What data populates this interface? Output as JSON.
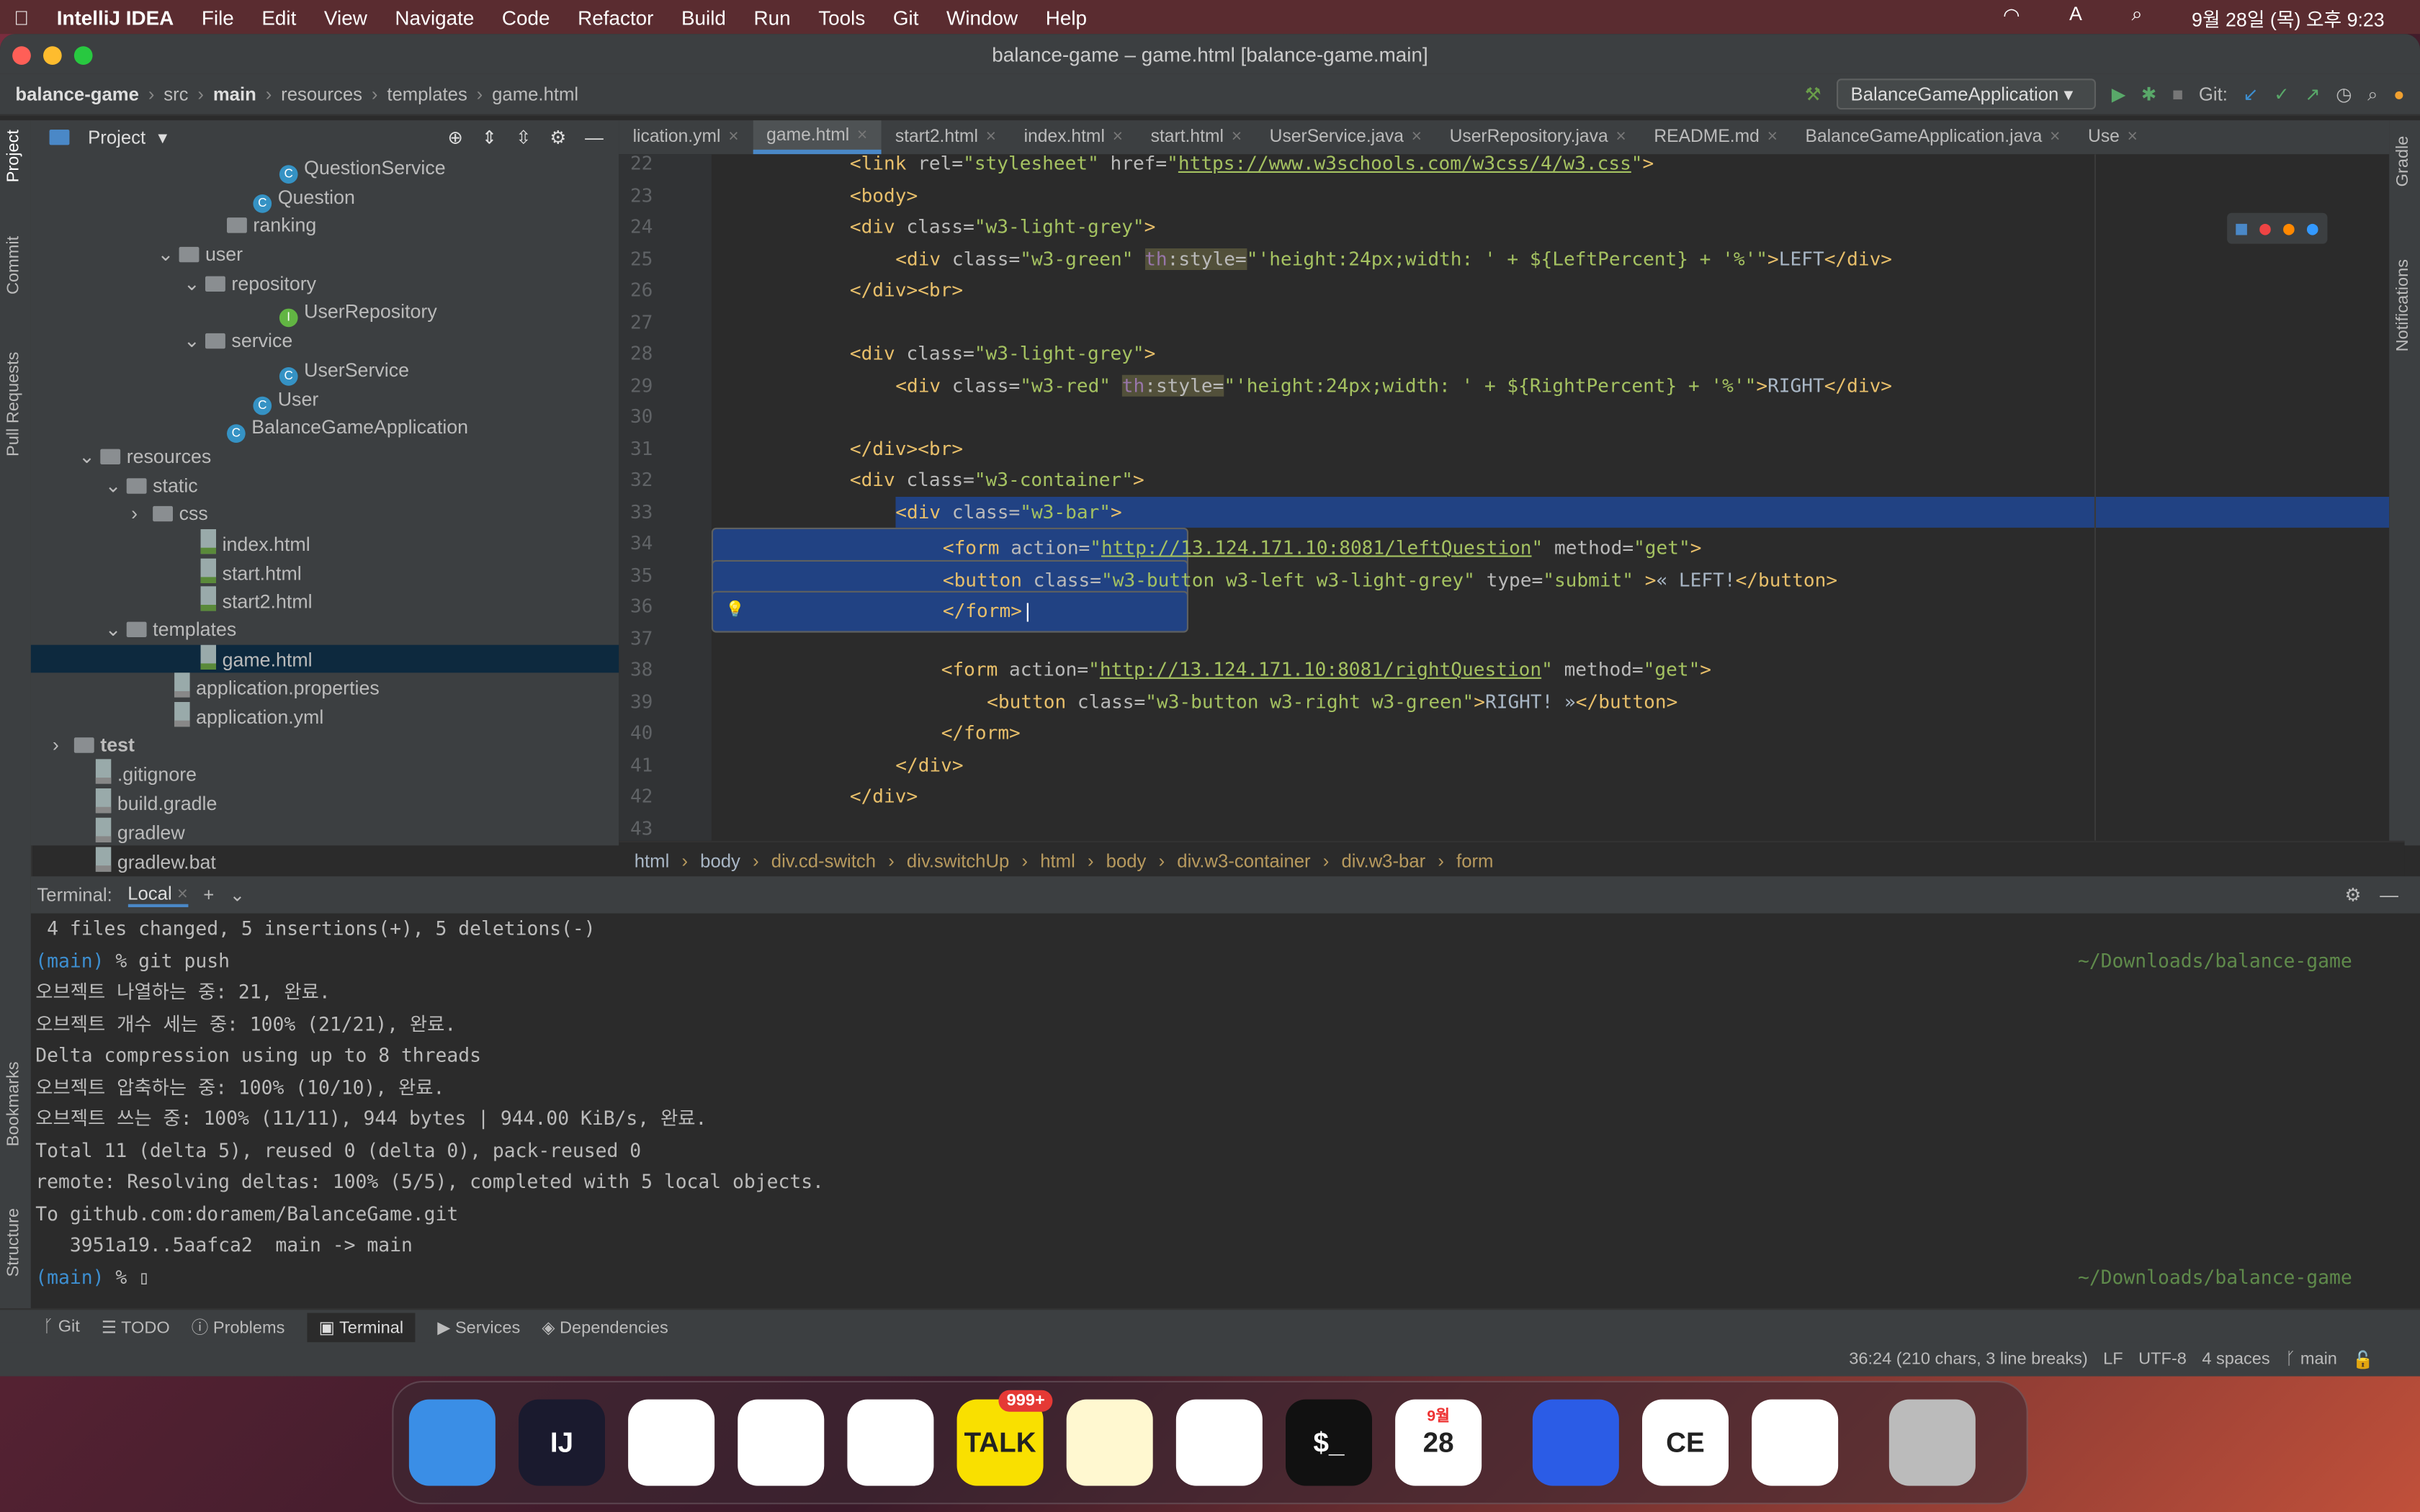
{
  "menubar": {
    "app": "IntelliJ IDEA",
    "items": [
      "File",
      "Edit",
      "View",
      "Navigate",
      "Code",
      "Refactor",
      "Build",
      "Run",
      "Tools",
      "Git",
      "Window",
      "Help"
    ],
    "clock": "9월 28일 (목) 오후 9:23",
    "input_indicator": "A"
  },
  "window": {
    "title": "balance-game – game.html [balance-game.main]"
  },
  "navbar": {
    "crumbs": [
      "balance-game",
      "src",
      "main",
      "resources",
      "templates",
      "game.html"
    ],
    "run_config": "BalanceGameApplication",
    "git_label": "Git:"
  },
  "left_strip": [
    "Project",
    "Commit",
    "Pull Requests",
    "Bookmarks",
    "Structure"
  ],
  "right_strip": [
    "Gradle",
    "Notifications"
  ],
  "project": {
    "title": "Project",
    "tree": [
      {
        "label": "QuestionService",
        "indent": 9,
        "icon": "class"
      },
      {
        "label": "Question",
        "indent": 8,
        "icon": "class"
      },
      {
        "label": "ranking",
        "indent": 7,
        "icon": "folder"
      },
      {
        "label": "user",
        "indent": 6,
        "icon": "folder",
        "open": true
      },
      {
        "label": "repository",
        "indent": 7,
        "icon": "folder",
        "open": true
      },
      {
        "label": "UserRepository",
        "indent": 9,
        "icon": "interface"
      },
      {
        "label": "service",
        "indent": 7,
        "icon": "folder",
        "open": true
      },
      {
        "label": "UserService",
        "indent": 9,
        "icon": "class"
      },
      {
        "label": "User",
        "indent": 8,
        "icon": "class"
      },
      {
        "label": "BalanceGameApplication",
        "indent": 7,
        "icon": "class"
      },
      {
        "label": "resources",
        "indent": 3,
        "icon": "folder",
        "open": true
      },
      {
        "label": "static",
        "indent": 4,
        "icon": "folder",
        "open": true
      },
      {
        "label": "css",
        "indent": 5,
        "icon": "folder",
        "closed": true
      },
      {
        "label": "index.html",
        "indent": 6,
        "icon": "html"
      },
      {
        "label": "start.html",
        "indent": 6,
        "icon": "html"
      },
      {
        "label": "start2.html",
        "indent": 6,
        "icon": "html"
      },
      {
        "label": "templates",
        "indent": 4,
        "icon": "folder",
        "open": true
      },
      {
        "label": "game.html",
        "indent": 6,
        "icon": "html",
        "selected": true
      },
      {
        "label": "application.properties",
        "indent": 5,
        "icon": "file"
      },
      {
        "label": "application.yml",
        "indent": 5,
        "icon": "file"
      },
      {
        "label": "test",
        "indent": 2,
        "icon": "folder",
        "closed": true
      },
      {
        "label": ".gitignore",
        "indent": 2,
        "icon": "file"
      },
      {
        "label": "build.gradle",
        "indent": 2,
        "icon": "file"
      },
      {
        "label": "gradlew",
        "indent": 2,
        "icon": "file"
      },
      {
        "label": "gradlew.bat",
        "indent": 2,
        "icon": "file"
      }
    ]
  },
  "tabs": [
    {
      "label": "lication.yml"
    },
    {
      "label": "game.html",
      "active": true
    },
    {
      "label": "start2.html"
    },
    {
      "label": "index.html"
    },
    {
      "label": "start.html"
    },
    {
      "label": "UserService.java"
    },
    {
      "label": "UserRepository.java"
    },
    {
      "label": "README.md"
    },
    {
      "label": "BalanceGameApplication.java"
    },
    {
      "label": "Use"
    }
  ],
  "editor": {
    "lines": [
      {
        "n": 22,
        "tokens": [
          [
            "t",
            "<link "
          ],
          [
            "a",
            "rel="
          ],
          [
            "s",
            "\"stylesheet\" "
          ],
          [
            "a",
            "href="
          ],
          [
            "s",
            "\""
          ],
          [
            "u",
            "https://www.w3schools.com/w3css/4/w3.css"
          ],
          [
            "s",
            "\""
          ],
          [
            "t",
            ">"
          ]
        ],
        "indent": 4
      },
      {
        "n": 23,
        "tokens": [
          [
            "t",
            "<body>"
          ]
        ],
        "indent": 4
      },
      {
        "n": 24,
        "tokens": [
          [
            "t",
            "<div "
          ],
          [
            "a",
            "class="
          ],
          [
            "s",
            "\"w3-light-grey\""
          ],
          [
            "t",
            ">"
          ]
        ],
        "indent": 4
      },
      {
        "n": 25,
        "tokens": [
          [
            "t",
            "<div "
          ],
          [
            "a",
            "class="
          ],
          [
            "s",
            "\"w3-green\" "
          ],
          [
            "p",
            "th"
          ],
          [
            "a",
            ":style="
          ],
          [
            "s",
            "\"'height:24px;width: ' + ${LeftPercent} + '%'\""
          ],
          [
            "t",
            ">"
          ],
          [
            "w",
            "LEFT"
          ],
          [
            "t",
            "</div>"
          ]
        ],
        "indent": 8
      },
      {
        "n": 26,
        "tokens": [
          [
            "t",
            "</div><br>"
          ]
        ],
        "indent": 4
      },
      {
        "n": 27,
        "tokens": [],
        "indent": 0
      },
      {
        "n": 28,
        "tokens": [
          [
            "t",
            "<div "
          ],
          [
            "a",
            "class="
          ],
          [
            "s",
            "\"w3-light-grey\""
          ],
          [
            "t",
            ">"
          ]
        ],
        "indent": 4
      },
      {
        "n": 29,
        "tokens": [
          [
            "t",
            "<div "
          ],
          [
            "a",
            "class="
          ],
          [
            "s",
            "\"w3-red\" "
          ],
          [
            "p",
            "th"
          ],
          [
            "a",
            ":style="
          ],
          [
            "s",
            "\"'height:24px;width: ' + ${RightPercent} + '%'\""
          ],
          [
            "t",
            ">"
          ],
          [
            "w",
            "RIGHT"
          ],
          [
            "t",
            "</div>"
          ]
        ],
        "indent": 8
      },
      {
        "n": 30,
        "tokens": [],
        "indent": 0
      },
      {
        "n": 31,
        "tokens": [
          [
            "t",
            "</div><br>"
          ]
        ],
        "indent": 4
      },
      {
        "n": 32,
        "tokens": [
          [
            "t",
            "<div "
          ],
          [
            "a",
            "class="
          ],
          [
            "s",
            "\"w3-container\""
          ],
          [
            "t",
            ">"
          ]
        ],
        "indent": 4
      },
      {
        "n": 33,
        "tokens": [
          [
            "t",
            "<div "
          ],
          [
            "a",
            "class="
          ],
          [
            "s",
            "\"w3-bar\""
          ],
          [
            "t",
            ">"
          ]
        ],
        "indent": 8,
        "selected_from": 8
      },
      {
        "n": 34,
        "tokens": [
          [
            "t",
            "<form "
          ],
          [
            "a",
            "action="
          ],
          [
            "s",
            "\""
          ],
          [
            "u",
            "http://13.124.171.10:8081/leftQuestion"
          ],
          [
            "s",
            "\" "
          ],
          [
            "a",
            "method="
          ],
          [
            "s",
            "\"get\""
          ],
          [
            "t",
            ">"
          ]
        ],
        "indent": 12,
        "selected": true
      },
      {
        "n": 35,
        "tokens": [
          [
            "t",
            "<button "
          ],
          [
            "a",
            "class="
          ],
          [
            "s",
            "\"w3-button w3-left w3-light-grey\" "
          ],
          [
            "a",
            "type="
          ],
          [
            "s",
            "\"submit\" "
          ],
          [
            "t",
            ">"
          ],
          [
            "w",
            "« LEFT!"
          ],
          [
            "t",
            "</button>"
          ]
        ],
        "indent": 12,
        "selected": true
      },
      {
        "n": 36,
        "tokens": [
          [
            "t",
            "</form>"
          ]
        ],
        "indent": 12,
        "selected": true,
        "current": true
      },
      {
        "n": 37,
        "tokens": [],
        "indent": 0
      },
      {
        "n": 38,
        "tokens": [
          [
            "t",
            "<form "
          ],
          [
            "a",
            "action="
          ],
          [
            "s",
            "\""
          ],
          [
            "u",
            "http://13.124.171.10:8081/rightQuestion"
          ],
          [
            "s",
            "\" "
          ],
          [
            "a",
            "method="
          ],
          [
            "s",
            "\"get\""
          ],
          [
            "t",
            ">"
          ]
        ],
        "indent": 12
      },
      {
        "n": 39,
        "tokens": [
          [
            "t",
            "<button "
          ],
          [
            "a",
            "class="
          ],
          [
            "s",
            "\"w3-button w3-right w3-green\""
          ],
          [
            "t",
            ">"
          ],
          [
            "w",
            "RIGHT! »"
          ],
          [
            "t",
            "</button>"
          ]
        ],
        "indent": 16
      },
      {
        "n": 40,
        "tokens": [
          [
            "t",
            "</form>"
          ]
        ],
        "indent": 12
      },
      {
        "n": 41,
        "tokens": [
          [
            "t",
            "</div>"
          ]
        ],
        "indent": 8
      },
      {
        "n": 42,
        "tokens": [
          [
            "t",
            "</div>"
          ]
        ],
        "indent": 4
      },
      {
        "n": 43,
        "tokens": [],
        "indent": 0
      }
    ]
  },
  "breadcrumb": [
    "html",
    "body",
    "div.cd-switch",
    "div.switchUp",
    "html",
    "body",
    "div.w3-container",
    "div.w3-bar",
    "form"
  ],
  "terminal": {
    "label": "Terminal:",
    "tab": "Local",
    "lines": [
      {
        "text": " 4 files changed, 5 insertions(+), 5 deletions(-)"
      },
      {
        "prompt": "(main)",
        "text": " % git push",
        "path": "~/Downloads/balance-game"
      },
      {
        "text": "오브젝트 나열하는 중: 21, 완료."
      },
      {
        "text": "오브젝트 개수 세는 중: 100% (21/21), 완료."
      },
      {
        "text": "Delta compression using up to 8 threads"
      },
      {
        "text": "오브젝트 압축하는 중: 100% (10/10), 완료."
      },
      {
        "text": "오브젝트 쓰는 중: 100% (11/11), 944 bytes | 944.00 KiB/s, 완료."
      },
      {
        "text": "Total 11 (delta 5), reused 0 (delta 0), pack-reused 0"
      },
      {
        "text": "remote: Resolving deltas: 100% (5/5), completed with 5 local objects."
      },
      {
        "text": "To github.com:doramem/BalanceGame.git"
      },
      {
        "text": "   3951a19..5aafca2  main -> main"
      },
      {
        "prompt": "(main)",
        "text": " % ▯",
        "path": "~/Downloads/balance-game"
      }
    ]
  },
  "bottom_tabs": [
    "Git",
    "TODO",
    "Problems",
    "Terminal",
    "Services",
    "Dependencies"
  ],
  "status": {
    "position": "36:24 (210 chars, 3 line breaks)",
    "line_sep": "LF",
    "encoding": "UTF-8",
    "indent": "4 spaces",
    "branch": "main"
  },
  "dock": {
    "items": [
      {
        "name": "Finder",
        "color": "#3a8ee6"
      },
      {
        "name": "IntelliJ IDEA",
        "label": "IJ",
        "color": "#1a1a2e"
      },
      {
        "name": "VS Code",
        "color": "#ffffff"
      },
      {
        "name": "Chrome",
        "color": "#ffffff"
      },
      {
        "name": "Safari",
        "color": "#ffffff"
      },
      {
        "name": "KakaoTalk",
        "label": "TALK",
        "color": "#f9e000",
        "badge": "999+"
      },
      {
        "name": "Notes",
        "color": "#fff8d0"
      },
      {
        "name": "Freeform",
        "color": "#ffffff"
      },
      {
        "name": "Terminal",
        "label": "$_",
        "color": "#111"
      },
      {
        "name": "Calendar",
        "label": "28",
        "sub": "9월",
        "color": "#ffffff"
      },
      {
        "name": "Grape",
        "color": "#2b5ce6"
      },
      {
        "name": "TablePlus",
        "label": "CE",
        "color": "#ffffff"
      },
      {
        "name": "Keynote",
        "color": "#ffffff"
      },
      {
        "name": "Trash",
        "color": "#bbbbbb"
      }
    ]
  }
}
